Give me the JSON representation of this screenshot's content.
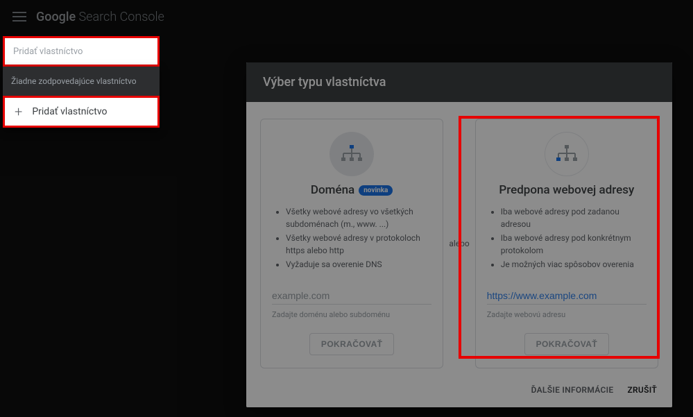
{
  "header": {
    "brand_google": "Google",
    "brand_sc": " Search Console"
  },
  "sidebar": {
    "search_placeholder": "Pridať vlastníctvo",
    "no_match": "Žiadne zodpovedajúce vlastníctvo",
    "add_label": "Pridať vlastníctvo"
  },
  "dialog": {
    "title": "Výber typu vlastníctva",
    "separator": "alebo",
    "domain": {
      "title": "Doména",
      "badge": "novinka",
      "bullets": [
        "Všetky webové adresy vo všetkých subdoménach (m., www. ...)",
        "Všetky webové adresy v protokoloch https alebo http",
        "Vyžaduje sa overenie DNS"
      ],
      "placeholder": "example.com",
      "hint": "Zadajte doménu alebo subdoménu",
      "button": "POKRAČOVAŤ"
    },
    "urlprefix": {
      "title": "Predpona webovej adresy",
      "bullets": [
        "Iba webové adresy pod zadanou adresou",
        "Iba webové adresy pod konkrétnym protokolom",
        "Je možných viac spôsobov overenia"
      ],
      "placeholder": "https://www.example.com",
      "hint": "Zadajte webovú adresu",
      "button": "POKRAČOVAŤ"
    },
    "footer": {
      "more": "ĎALŠIE INFORMÁCIE",
      "cancel": "ZRUŠIŤ"
    }
  }
}
